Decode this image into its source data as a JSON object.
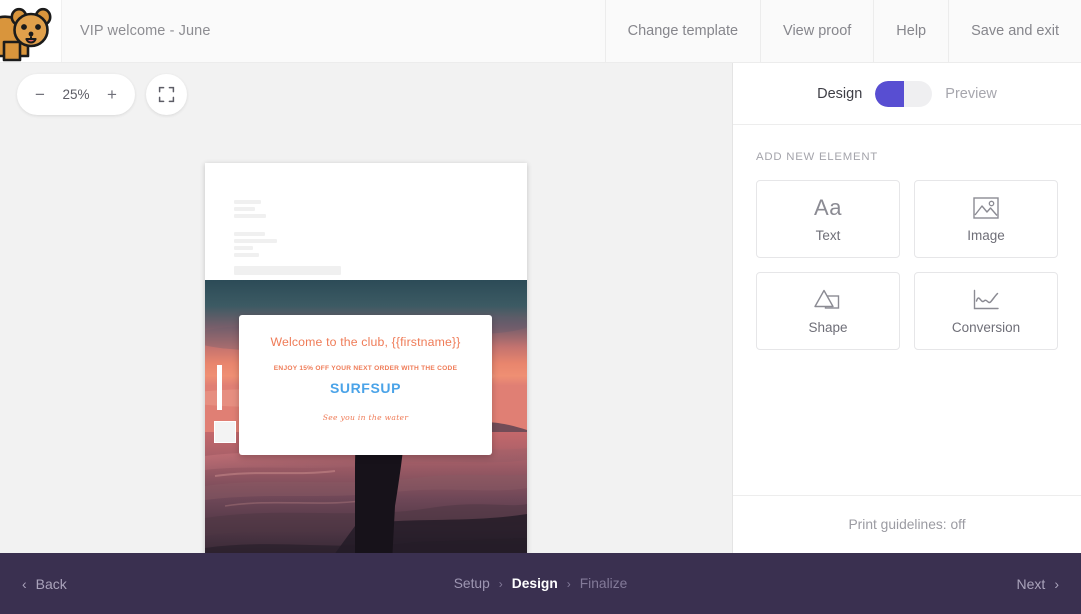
{
  "topbar": {
    "logo_name": "quokka-mascot-logo",
    "document_title": "VIP welcome - June",
    "nav": [
      {
        "label": "Change template",
        "name": "change-template"
      },
      {
        "label": "View proof",
        "name": "view-proof"
      },
      {
        "label": "Help",
        "name": "help"
      },
      {
        "label": "Save and exit",
        "name": "save-and-exit"
      }
    ]
  },
  "canvas": {
    "zoom": {
      "minus_label": "−",
      "value": "25%",
      "plus_label": "+",
      "fit_icon": "fit-to-screen-icon"
    },
    "document": {
      "hero": {
        "headline": "Welcome to the club, {{firstname}}",
        "offer": "ENJOY 15% OFF YOUR NEXT ORDER WITH THE CODE",
        "promo_code": "SURFSUP",
        "signoff": "See you in the water",
        "headline_color": "#ef7b57",
        "offer_color": "#ef7b57",
        "promo_code_color": "#4aa3e8",
        "signoff_color": "#ef7b57",
        "photo_description": "sunset-beach-shaka-hand-silhouette"
      }
    }
  },
  "side_panel": {
    "mode_toggle": {
      "left_label": "Design",
      "right_label": "Preview",
      "active": "Design",
      "accent_color": "#584ed2"
    },
    "section_title": "ADD NEW ELEMENT",
    "elements": [
      {
        "label": "Text",
        "icon": "text-aa-icon",
        "glyph": "Aa",
        "name": "add-element-text"
      },
      {
        "label": "Image",
        "icon": "image-icon",
        "name": "add-element-image"
      },
      {
        "label": "Shape",
        "icon": "shape-icon",
        "name": "add-element-shape"
      },
      {
        "label": "Conversion",
        "icon": "line-chart-icon",
        "name": "add-element-conversion"
      }
    ],
    "footer_text": "Print guidelines: off"
  },
  "bottombar": {
    "back_label": "Back",
    "back_chevron": "‹",
    "next_label": "Next",
    "next_chevron": "›",
    "breadcrumb": [
      {
        "label": "Setup",
        "state": "done"
      },
      {
        "label": "Design",
        "state": "active"
      },
      {
        "label": "Finalize",
        "state": "future"
      }
    ],
    "separator": "›",
    "background_color": "#3a3050"
  }
}
